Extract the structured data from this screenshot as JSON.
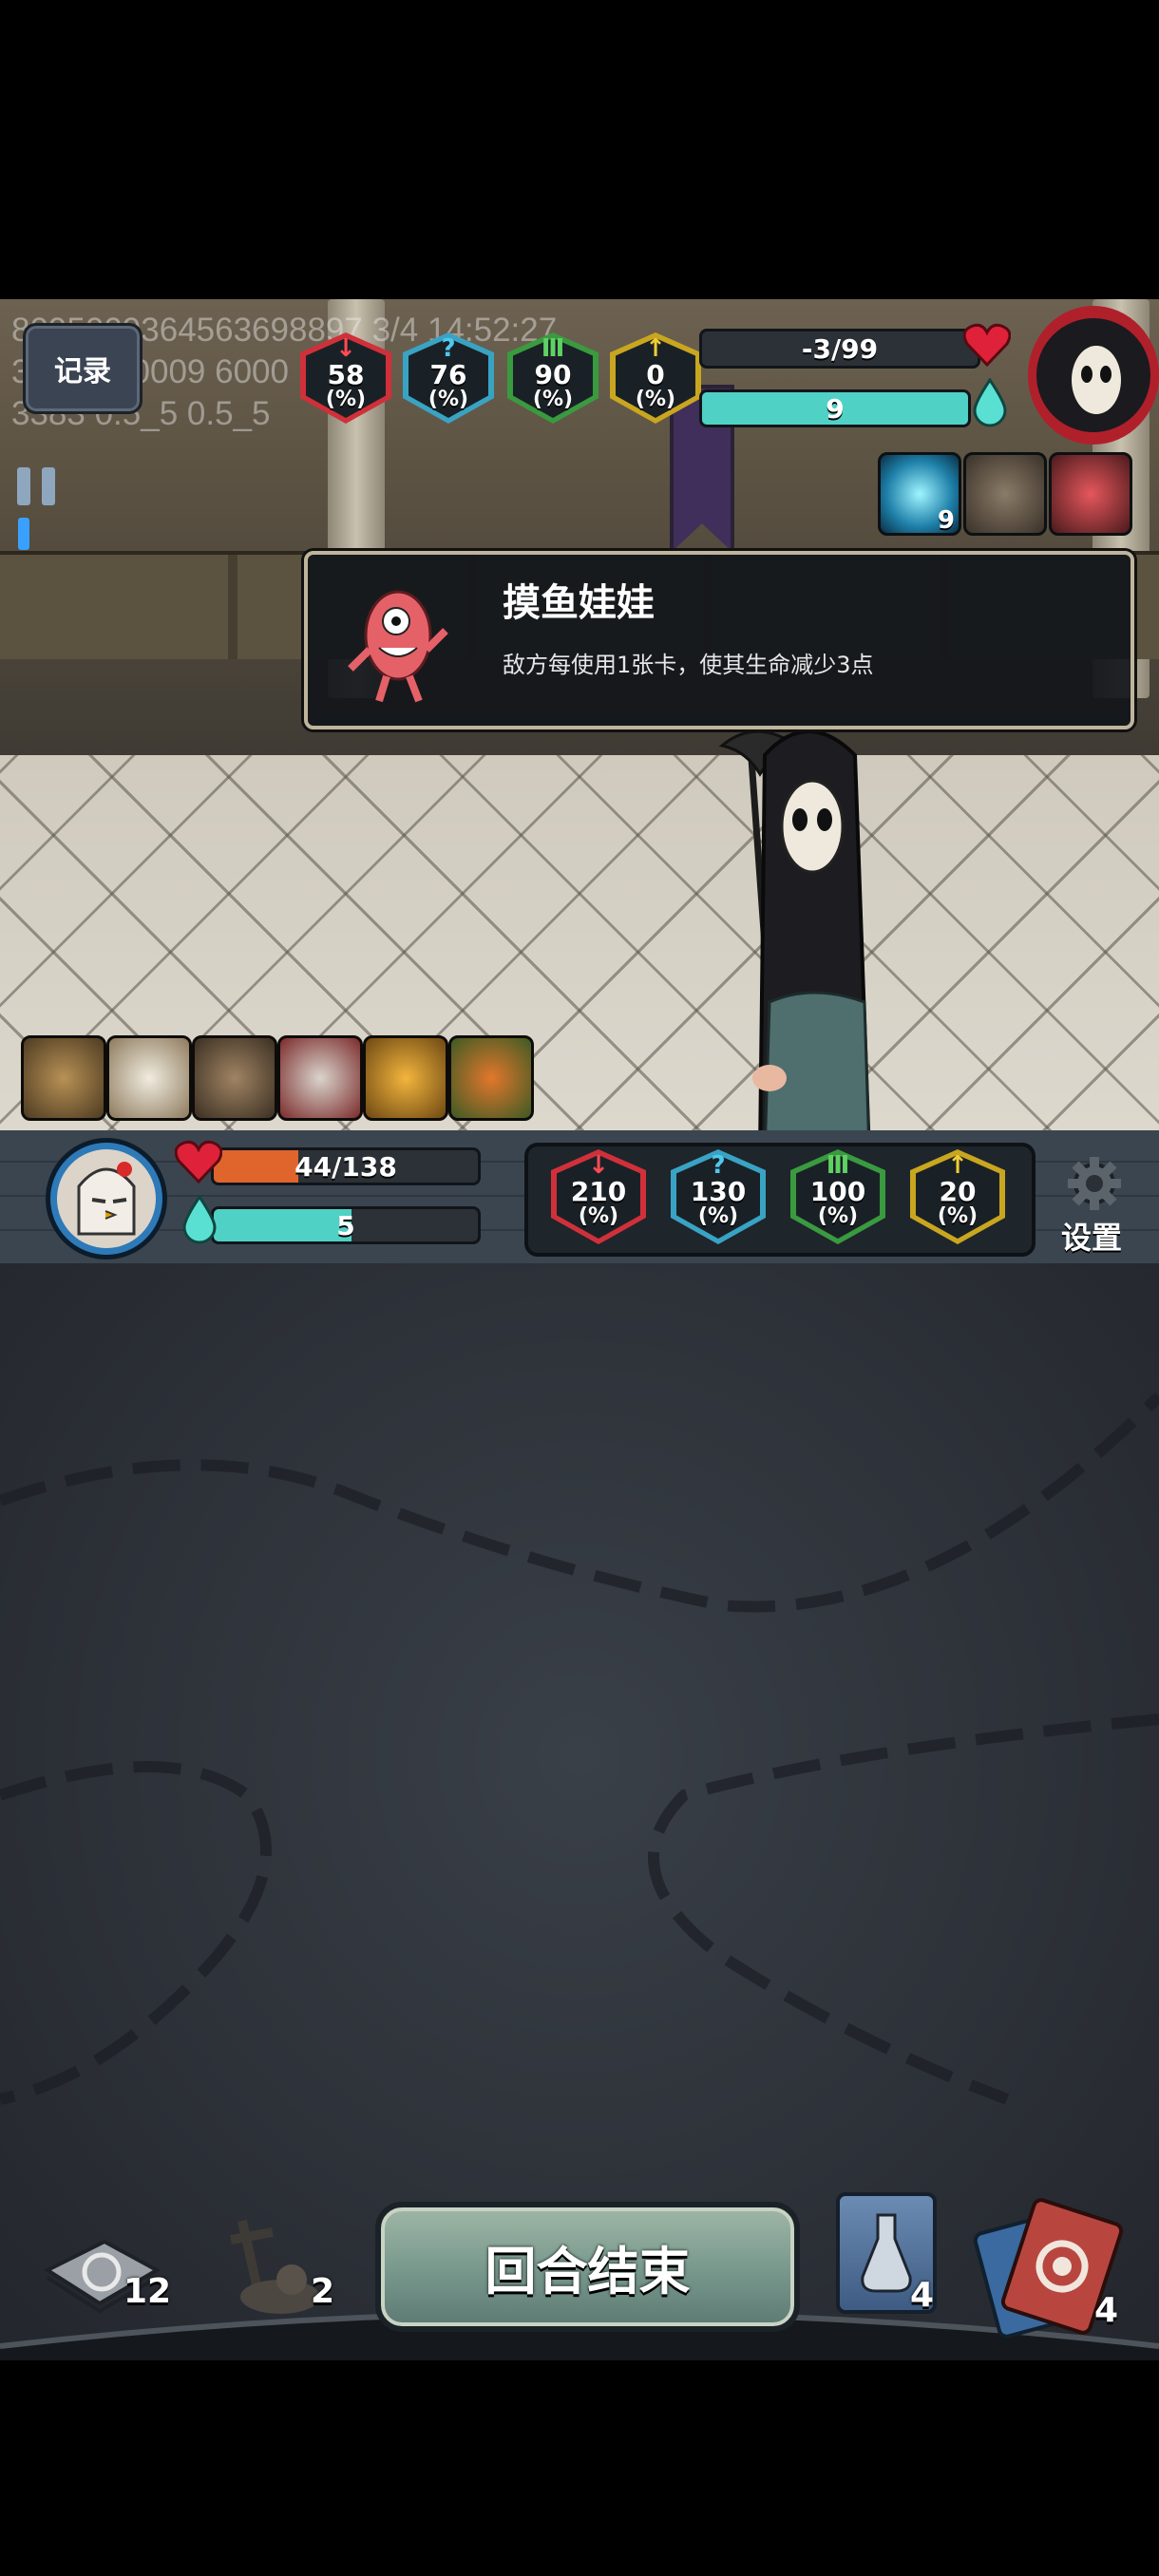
{
  "debug": {
    "line1": "8095009364563698897 3/4 14:52:27",
    "line2": "30010 50009 6000",
    "line3": "3383 0.5_5 0.5_5"
  },
  "record_label": "记录",
  "enemy": {
    "stats": [
      {
        "name": "attack",
        "value": "58",
        "unit": "(%)",
        "color": "#d0303a"
      },
      {
        "name": "mystery",
        "value": "76",
        "unit": "(%)",
        "color": "#39a3c4"
      },
      {
        "name": "defense",
        "value": "90",
        "unit": "(%)",
        "color": "#3a9a3f"
      },
      {
        "name": "support",
        "value": "0",
        "unit": "(%)",
        "color": "#c9a61f"
      }
    ],
    "hp_text": "-3/99",
    "hp_fraction": 0,
    "energy_text": "9",
    "energy_fraction": 1,
    "buffs": [
      {
        "icon": "spirit-mask-icon",
        "count": "9"
      },
      {
        "icon": "beast-skull-icon",
        "count": ""
      },
      {
        "icon": "fish-doll-icon",
        "count": ""
      }
    ]
  },
  "tooltip": {
    "title": "摸鱼娃娃",
    "desc": "敌方每使用1张卡，使其生命减少3点"
  },
  "relics": [
    "pocket-watch-icon",
    "ice-cream-icon",
    "owl-doll-icon",
    "teacup-icon",
    "broom-icon",
    "flower-pot-icon"
  ],
  "player": {
    "hp_text": "44/138",
    "hp_fraction": 0.32,
    "energy_text": "5",
    "energy_fraction": 0.52,
    "stats": [
      {
        "name": "attack",
        "value": "210",
        "unit": "(%)",
        "color": "#d0303a"
      },
      {
        "name": "mystery",
        "value": "130",
        "unit": "(%)",
        "color": "#39a3c4"
      },
      {
        "name": "defense",
        "value": "100",
        "unit": "(%)",
        "color": "#3a9a3f"
      },
      {
        "name": "support",
        "value": "20",
        "unit": "(%)",
        "color": "#c9a61f"
      }
    ]
  },
  "settings_label": "设置",
  "end_turn_label": "回合结束",
  "piles": {
    "draw": "12",
    "grave": "2",
    "potion": "4",
    "discard": "4"
  }
}
